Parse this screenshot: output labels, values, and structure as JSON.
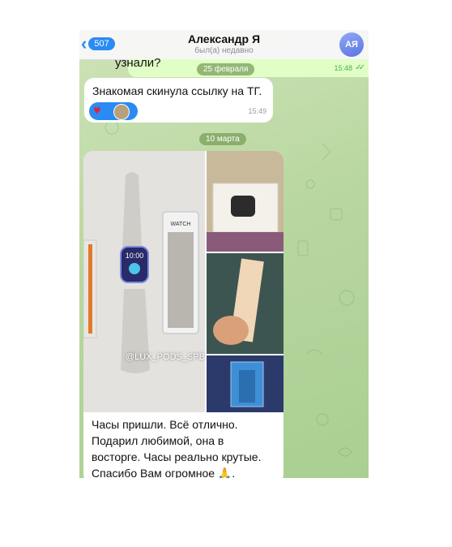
{
  "header": {
    "back_count": "507",
    "title": "Александр Я",
    "subtitle": "был(а) недавно",
    "avatar_initials": "АЯ"
  },
  "messages": {
    "outgoing_text": "узнали?",
    "outgoing_time": "15:48",
    "date_1": "25 февраля",
    "incoming_text": "Знакомая скинула ссылку на ТГ.",
    "incoming_time": "15:49",
    "date_2": "10 марта",
    "photo_watermark": "@LUX_PODS_SPB",
    "watch_time": "10:00",
    "band_label": "WATCH",
    "caption_lines": [
      "Часы пришли. Всё отлично.",
      "Подарил любимой, она в",
      "восторге. Часы реально крутые.",
      "Спасибо Вам огромное 🙏."
    ]
  },
  "colors": {
    "accent": "#2a8bf2",
    "outgoing_bubble": "#e1fec6",
    "wallpaper": "#b9d7a0"
  }
}
